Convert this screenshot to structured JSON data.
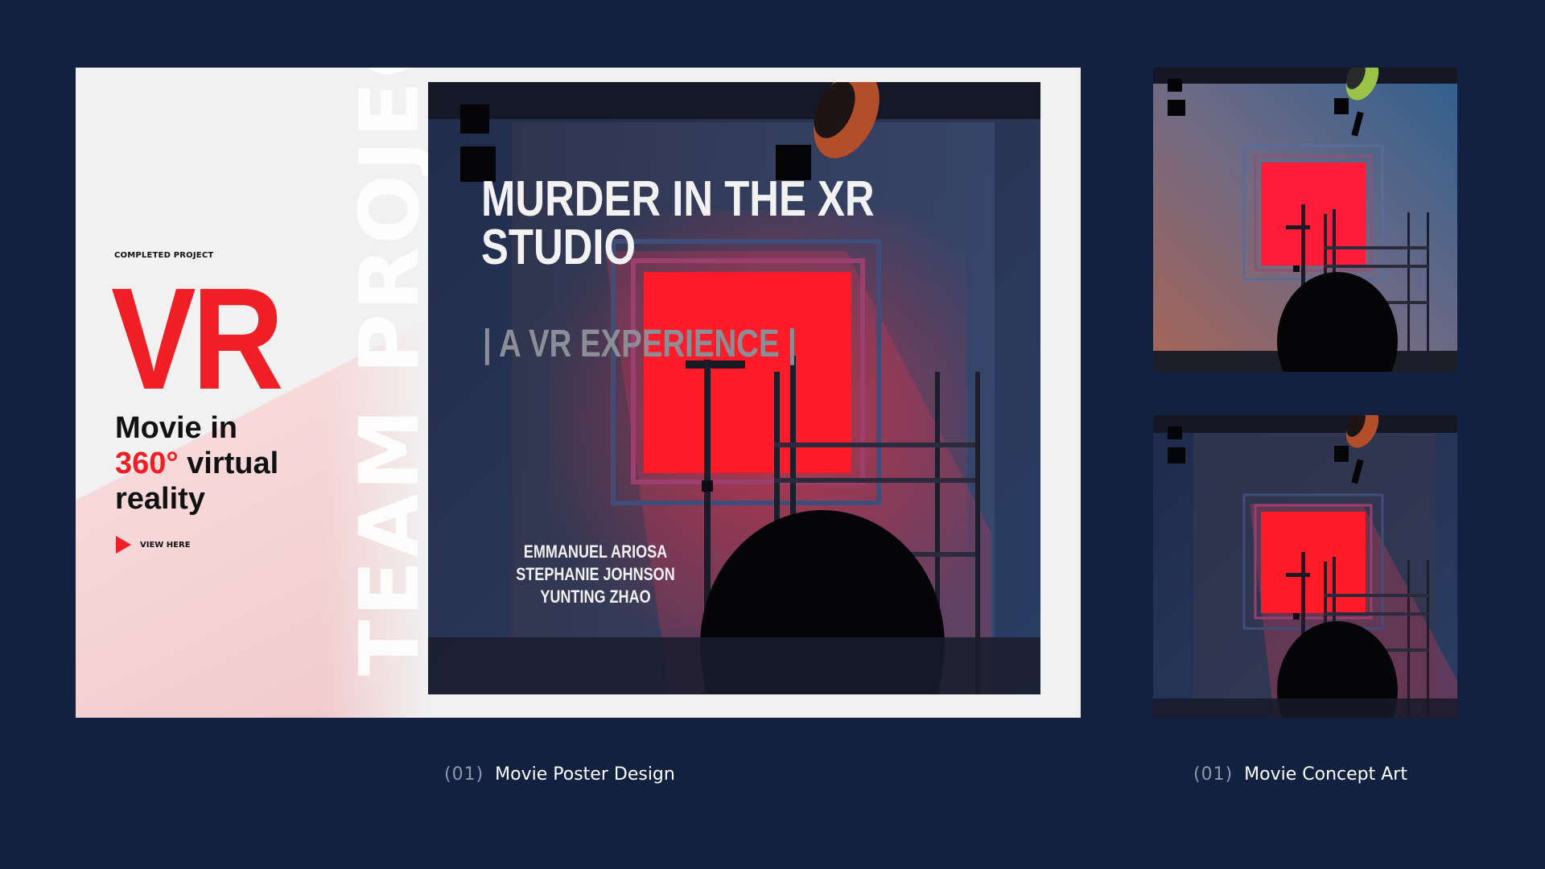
{
  "card": {
    "eyebrow": "COMPLETED PROJECT",
    "big_title": "VR",
    "tagline_line1": "Movie in",
    "tagline_highlight": "360°",
    "tagline_word": "virtual",
    "tagline_line3": "reality",
    "view_label": "VIEW HERE",
    "side_text": "TEAM PROJECT"
  },
  "poster": {
    "title_line1": "MURDER IN THE XR",
    "title_line2": "STUDIO",
    "subtitle": "| A VR EXPERIENCE |",
    "credits": [
      "EMMANUEL ARIOSA",
      "STEPHANIE JOHNSON",
      "YUNTING ZHAO"
    ]
  },
  "captions": [
    {
      "number": "(01)",
      "label": "Movie Poster Design"
    },
    {
      "number": "(01)",
      "label": "Movie Concept Art"
    }
  ],
  "colors": {
    "background": "#12213f",
    "accent_red": "#ef1f25",
    "card": "#f1f1f1"
  }
}
